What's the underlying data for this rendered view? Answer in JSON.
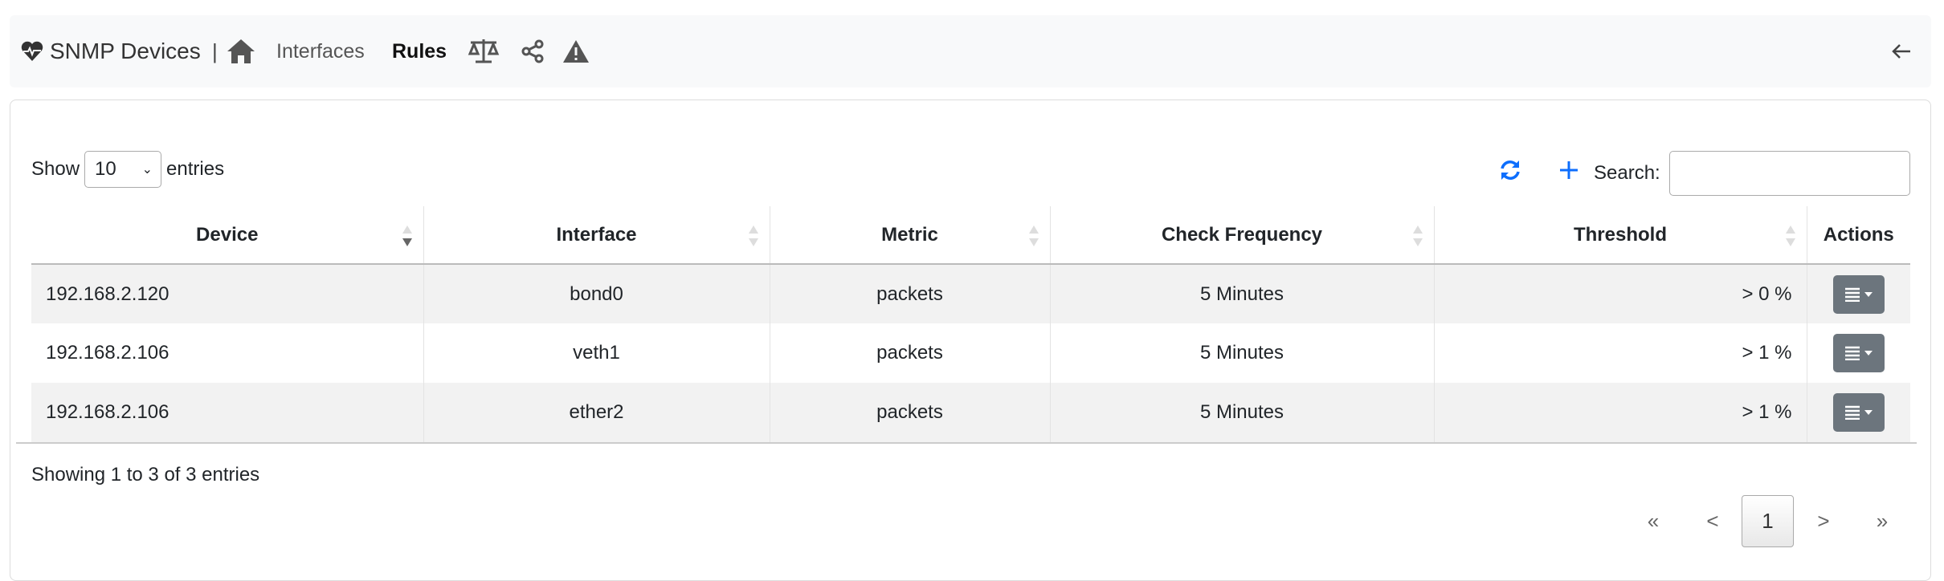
{
  "nav": {
    "title": "SNMP Devices",
    "separator": "|",
    "interfaces": "Interfaces",
    "rules": "Rules",
    "icons": [
      "heartbeat-icon",
      "home-icon",
      "balance-scale-icon",
      "share-icon",
      "warning-icon",
      "back-arrow-icon"
    ]
  },
  "controls": {
    "show_label": "Show",
    "page_size": "10",
    "entries_label": "entries",
    "search_label": "Search:",
    "search_value": "",
    "accent": "#0d6efd"
  },
  "table": {
    "columns": [
      "Device",
      "Interface",
      "Metric",
      "Check Frequency",
      "Threshold",
      "Actions"
    ],
    "rows": [
      {
        "device": "192.168.2.120",
        "interface": "bond0",
        "metric": "packets",
        "frequency": "5 Minutes",
        "threshold": "> 0 %"
      },
      {
        "device": "192.168.2.106",
        "interface": "veth1",
        "metric": "packets",
        "frequency": "5 Minutes",
        "threshold": "> 1 %"
      },
      {
        "device": "192.168.2.106",
        "interface": "ether2",
        "metric": "packets",
        "frequency": "5 Minutes",
        "threshold": "> 1 %"
      }
    ]
  },
  "footer": {
    "info": "Showing 1 to 3 of 3 entries",
    "first": "«",
    "prev": "<",
    "page": "1",
    "next": ">",
    "last": "»"
  }
}
